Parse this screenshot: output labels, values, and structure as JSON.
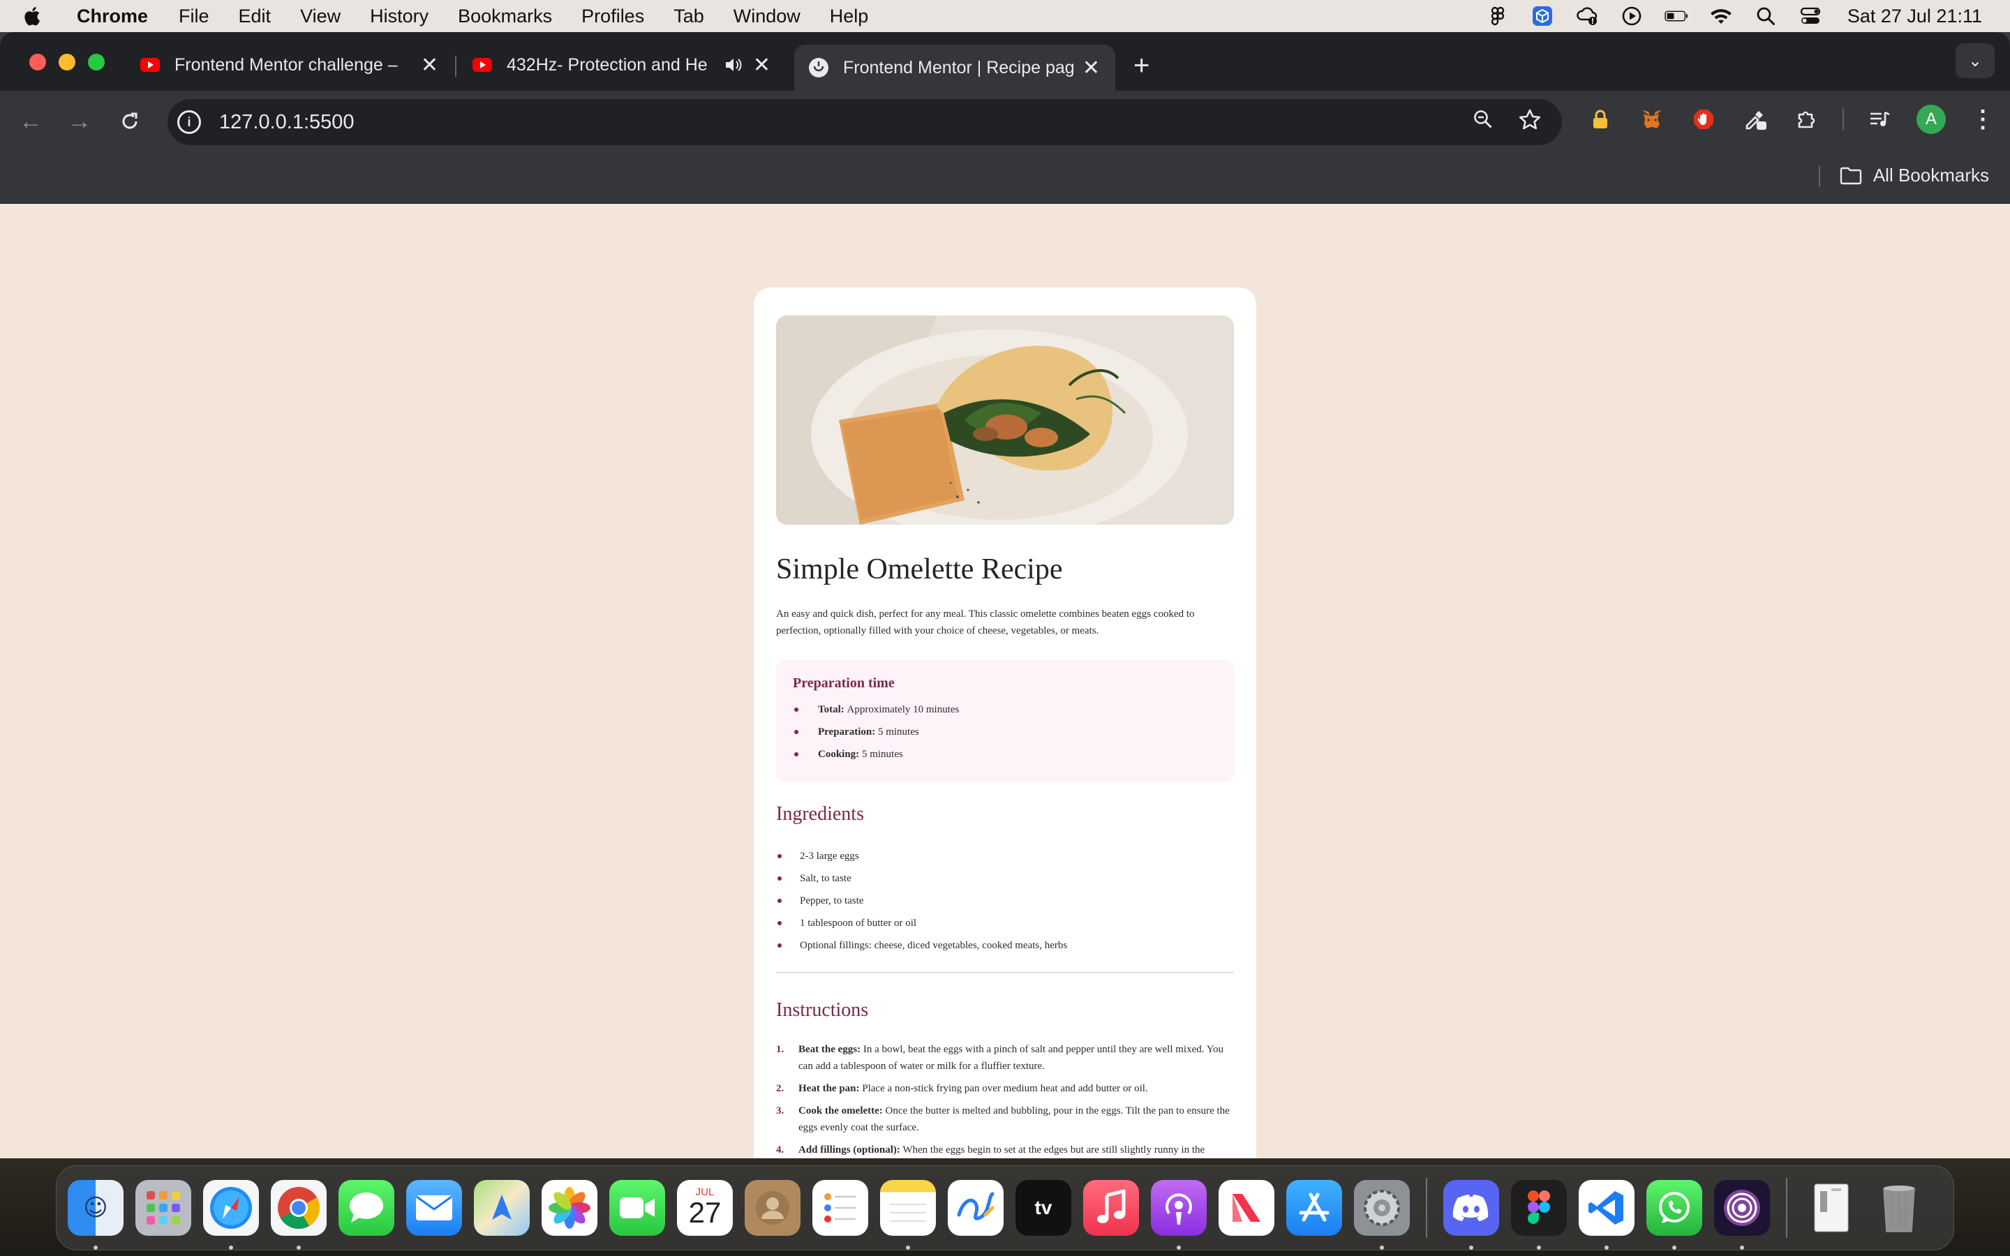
{
  "menubar": {
    "app_name": "Chrome",
    "items": [
      "File",
      "Edit",
      "View",
      "History",
      "Bookmarks",
      "Profiles",
      "Tab",
      "Window",
      "Help"
    ],
    "clock": "Sat 27 Jul  21:11"
  },
  "browser": {
    "tabs": [
      {
        "title": "Frontend Mentor challenge – ",
        "favicon": "youtube-icon",
        "active": false
      },
      {
        "title": "432Hz- Protection and He",
        "favicon": "youtube-icon",
        "active": false,
        "playing_audio": true
      },
      {
        "title": "Frontend Mentor | Recipe pag",
        "favicon": "frontend-mentor-icon",
        "active": true
      }
    ],
    "url": "127.0.0.1:5500",
    "bookmarks_label": "All Bookmarks",
    "profile_initial": "A",
    "colors": {
      "tabstrip": "#202124",
      "toolbar": "#35363a",
      "profile": "#34a853"
    }
  },
  "recipe": {
    "title": "Simple Omelette Recipe",
    "intro": "An easy and quick dish, perfect for any meal. This classic omelette combines beaten eggs cooked to perfection, optionally filled with your choice of cheese, vegetables, or meats.",
    "prep": {
      "heading": "Preparation time",
      "items": [
        {
          "label": "Total:",
          "value": "Approximately 10 minutes"
        },
        {
          "label": "Preparation:",
          "value": "5 minutes"
        },
        {
          "label": "Cooking:",
          "value": "5 minutes"
        }
      ]
    },
    "ingredients": {
      "heading": "Ingredients",
      "items": [
        "2-3 large eggs",
        "Salt, to taste",
        "Pepper, to taste",
        "1 tablespoon of butter or oil",
        "Optional fillings: cheese, diced vegetables, cooked meats, herbs"
      ]
    },
    "instructions": {
      "heading": "Instructions",
      "items": [
        {
          "num": "1.",
          "label": "Beat the eggs:",
          "text": "In a bowl, beat the eggs with a pinch of salt and pepper until they are well mixed. You can add a tablespoon of water or milk for a fluffier texture."
        },
        {
          "num": "2.",
          "label": "Heat the pan:",
          "text": "Place a non-stick frying pan over medium heat and add butter or oil."
        },
        {
          "num": "3.",
          "label": "Cook the omelette:",
          "text": "Once the butter is melted and bubbling, pour in the eggs. Tilt the pan to ensure the eggs evenly coat the surface."
        },
        {
          "num": "4.",
          "label": "Add fillings (optional):",
          "text": "When the eggs begin to set at the edges but are still slightly runny in the middle, sprinkle your chosen fillings over one half of the omelette."
        }
      ]
    },
    "colors": {
      "page_bg": "#f3e5da",
      "accent": "#7a284b",
      "prep_bg": "#fdf3f8",
      "title": "#24242a"
    }
  },
  "dock": {
    "calendar": {
      "month": "JUL",
      "day": "27"
    },
    "apps": [
      "finder-icon",
      "launchpad-icon",
      "safari-icon",
      "chrome-icon",
      "messages-icon",
      "mail-icon",
      "maps-icon",
      "photos-icon",
      "facetime-icon",
      "calendar-icon",
      "contacts-icon",
      "reminders-icon",
      "notes-icon",
      "freeform-icon",
      "apple-tv-icon",
      "music-icon",
      "podcasts-icon",
      "news-icon",
      "app-store-icon",
      "system-settings-icon",
      "discord-icon",
      "figma-icon",
      "vscode-icon",
      "whatsapp-icon",
      "tor-browser-icon",
      "downloads-stack-icon",
      "trash-icon"
    ]
  }
}
